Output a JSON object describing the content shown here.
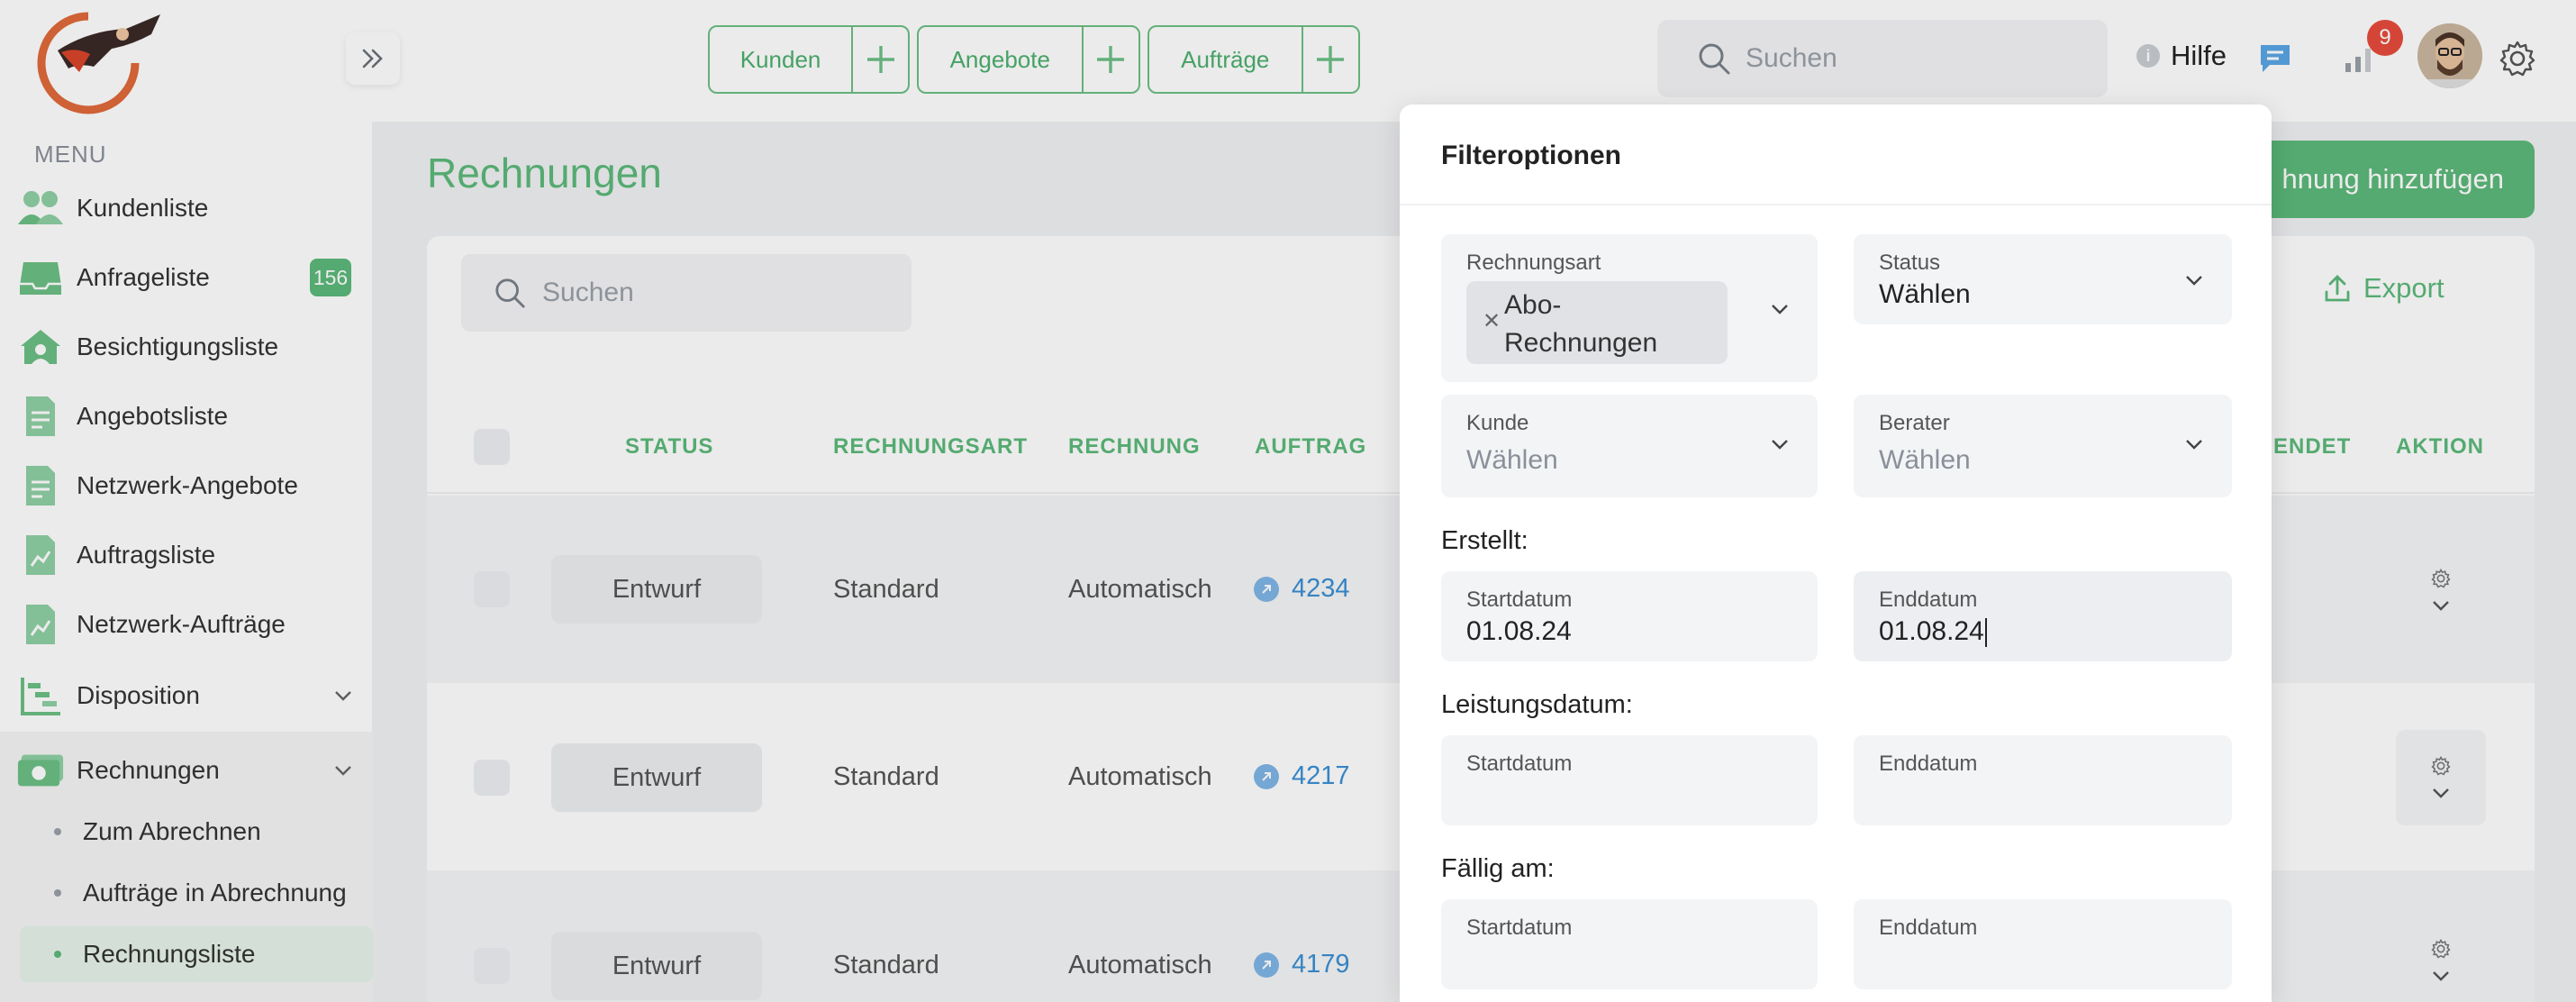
{
  "topbar": {
    "quick_actions": [
      {
        "label": "Kunden"
      },
      {
        "label": "Angebote"
      },
      {
        "label": "Aufträge"
      }
    ],
    "search_placeholder": "Suchen",
    "help_label": "Hilfe",
    "notification_count": "9"
  },
  "sidebar": {
    "menu_label": "MENU",
    "items": [
      {
        "label": "Kundenliste",
        "icon": "users-icon"
      },
      {
        "label": "Anfrageliste",
        "icon": "inbox-icon",
        "badge": "156"
      },
      {
        "label": "Besichtigungsliste",
        "icon": "house-icon"
      },
      {
        "label": "Angebotsliste",
        "icon": "document-icon"
      },
      {
        "label": "Netzwerk-Angebote",
        "icon": "document-icon"
      },
      {
        "label": "Auftragsliste",
        "icon": "chart-document-icon"
      },
      {
        "label": "Netzwerk-Aufträge",
        "icon": "chart-document-icon"
      },
      {
        "label": "Disposition",
        "icon": "gantt-icon"
      },
      {
        "label": "Rechnungen",
        "icon": "money-icon"
      }
    ],
    "sub_items": [
      {
        "label": "Zum Abrechnen"
      },
      {
        "label": "Aufträge in Abrechnung"
      },
      {
        "label": "Rechnungsliste"
      }
    ]
  },
  "main": {
    "title": "Rechnungen",
    "add_button": "hnung hinzufügen",
    "search_placeholder": "Suchen",
    "export_label": "Export",
    "columns": {
      "status": "STATUS",
      "rechnungsart": "RECHNUNGSART",
      "rechnung": "RECHNUNG",
      "auftrag": "AUFTRAG",
      "gesendet": "ENDET",
      "aktion": "AKTION"
    },
    "rows": [
      {
        "status": "Entwurf",
        "rechnungsart": "Standard",
        "rechnung": "Automatisch",
        "auftrag": "4234"
      },
      {
        "status": "Entwurf",
        "rechnungsart": "Standard",
        "rechnung": "Automatisch",
        "auftrag": "4217"
      },
      {
        "status": "Entwurf",
        "rechnungsart": "Standard",
        "rechnung": "Automatisch",
        "auftrag": "4179"
      }
    ]
  },
  "filter": {
    "title": "Filteroptionen",
    "rechnungsart": {
      "label": "Rechnungsart",
      "chip_line1": "Abo-",
      "chip_line2": "Rechnungen"
    },
    "status": {
      "label": "Status",
      "value": "Wählen"
    },
    "kunde": {
      "label": "Kunde",
      "placeholder": "Wählen"
    },
    "berater": {
      "label": "Berater",
      "placeholder": "Wählen"
    },
    "erstellt": {
      "label": "Erstellt:",
      "start_label": "Startdatum",
      "start_value": "01.08.24",
      "end_label": "Enddatum",
      "end_value": "01.08.24"
    },
    "leistungsdatum": {
      "label": "Leistungsdatum:",
      "start_label": "Startdatum",
      "end_label": "Enddatum"
    },
    "faellig": {
      "label": "Fällig am:",
      "start_label": "Startdatum",
      "end_label": "Enddatum"
    }
  },
  "colors": {
    "accent": "#5cb97a",
    "link": "#3b8fd4",
    "badge_red": "#e84b3c"
  }
}
